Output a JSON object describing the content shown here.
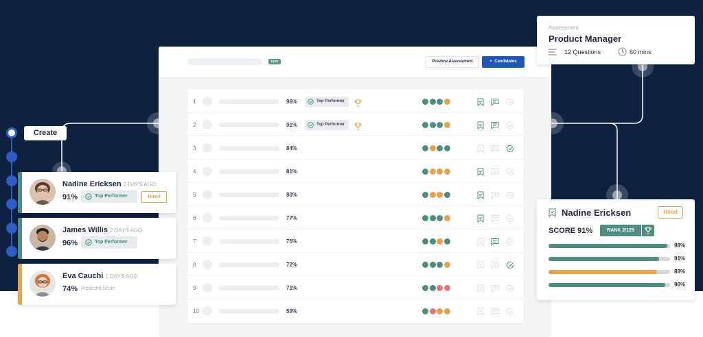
{
  "colors": {
    "navy": "#0e2240",
    "primary_blue": "#1f57b7",
    "teal": "#4e8d80",
    "orange": "#e9a24c",
    "red": "#e07a7a"
  },
  "panel": {
    "live_badge": "Live",
    "preview_button": "Preview Assessment",
    "candidates_button": "Candidates",
    "candidates_icon": "plus-icon"
  },
  "table": {
    "rows": [
      {
        "rank": "1",
        "score": "96%",
        "badge": "Top Performer",
        "trophy": true,
        "dots": [
          "teal",
          "teal",
          "teal",
          "orange"
        ],
        "icons": {
          "bookmark": true,
          "comment": true,
          "check": false
        }
      },
      {
        "rank": "2",
        "score": "91%",
        "badge": "Top Performer",
        "trophy": true,
        "dots": [
          "teal",
          "teal",
          "teal",
          "orange"
        ],
        "icons": {
          "bookmark": true,
          "comment": true,
          "check": false
        }
      },
      {
        "rank": "3",
        "score": "84%",
        "badge": "",
        "trophy": false,
        "dots": [
          "teal",
          "orange",
          "teal",
          "teal"
        ],
        "icons": {
          "bookmark": false,
          "comment": false,
          "check": true
        }
      },
      {
        "rank": "4",
        "score": "81%",
        "badge": "",
        "trophy": false,
        "dots": [
          "teal",
          "orange",
          "orange",
          "orange"
        ],
        "icons": {
          "bookmark": true,
          "comment": false,
          "check": false
        }
      },
      {
        "rank": "5",
        "score": "80%",
        "badge": "",
        "trophy": false,
        "dots": [
          "teal",
          "orange",
          "orange",
          "teal"
        ],
        "icons": {
          "bookmark": true,
          "comment": false,
          "check": false
        }
      },
      {
        "rank": "6",
        "score": "77%",
        "badge": "",
        "trophy": false,
        "dots": [
          "teal",
          "teal",
          "teal",
          "orange"
        ],
        "icons": {
          "bookmark": true,
          "comment": false,
          "check": false
        }
      },
      {
        "rank": "7",
        "score": "75%",
        "badge": "",
        "trophy": false,
        "dots": [
          "teal",
          "teal",
          "orange",
          "teal"
        ],
        "icons": {
          "bookmark": false,
          "comment": true,
          "check": false
        }
      },
      {
        "rank": "8",
        "score": "72%",
        "badge": "",
        "trophy": false,
        "dots": [
          "teal",
          "teal",
          "teal",
          "orange"
        ],
        "icons": {
          "bookmark": false,
          "comment": false,
          "check": true
        }
      },
      {
        "rank": "9",
        "score": "71%",
        "badge": "",
        "trophy": false,
        "dots": [
          "teal",
          "teal",
          "red",
          "red"
        ],
        "icons": {
          "bookmark": false,
          "comment": false,
          "check": false
        }
      },
      {
        "rank": "10",
        "score": "59%",
        "badge": "",
        "trophy": false,
        "dots": [
          "teal",
          "red",
          "orange",
          "orange"
        ],
        "icons": {
          "bookmark": false,
          "comment": false,
          "check": false
        }
      }
    ]
  },
  "create": {
    "label": "Create"
  },
  "candidates": [
    {
      "name": "Nadine Ericksen",
      "days": "2 DAYS AGO",
      "score": "91%",
      "tag": "Top Performer",
      "status": "Hired",
      "stripe": "#4e8d80"
    },
    {
      "name": "James Willis",
      "days": "2 DAYS AGO",
      "score": "96%",
      "tag": "Top Performer",
      "status": "",
      "stripe": "#4e8d80"
    },
    {
      "name": "Eva Cauchi",
      "days": "1 DAYS AGO",
      "score": "74%",
      "tag": "Predicted Score",
      "status": "",
      "stripe": "#e9a24c"
    }
  ],
  "assessment": {
    "label": "Assessment",
    "title": "Product Manager",
    "questions": "12 Questions",
    "duration": "60 mins"
  },
  "detail": {
    "name": "Nadine Ericksen",
    "status": "Hired",
    "score_label": "SCORE 91%",
    "rank": "RANK 2/125",
    "bars": [
      {
        "label": "98%",
        "value": 0.98,
        "color": "#4e8d80"
      },
      {
        "label": "91%",
        "value": 0.91,
        "color": "#4e8d80"
      },
      {
        "label": "89%",
        "value": 0.89,
        "color": "#e9a24c"
      },
      {
        "label": "96%",
        "value": 0.96,
        "color": "#4e8d80"
      }
    ]
  }
}
